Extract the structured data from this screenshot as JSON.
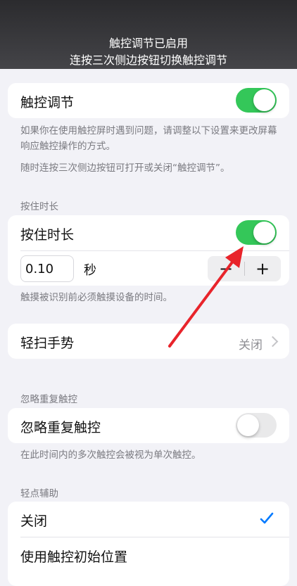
{
  "banner": {
    "line1": "触控调节已启用",
    "line2": "连按三次侧边按钮切换触控调节"
  },
  "touch_accommodations": {
    "label": "触控调节",
    "enabled": true,
    "note1": "如果你在使用触控屏时遇到问题，请调整以下设置来更改屏幕响应触控操作的方式。",
    "note2": "随时连按三次侧边按钮可打开或关闭“触控调节”。"
  },
  "hold_duration": {
    "section_title": "按住时长",
    "label": "按住时长",
    "enabled": true,
    "value": "0.10",
    "unit": "秒",
    "minus": "−",
    "plus": "+",
    "note": "触摸被识别前必须触摸设备的时间。"
  },
  "swipe_gestures": {
    "label": "轻扫手势",
    "value": "关闭"
  },
  "ignore_repeat": {
    "section_title": "忽略重复触控",
    "label": "忽略重复触控",
    "enabled": false,
    "note": "在此时间内的多次触控会被视为单次触控。"
  },
  "tap_assistance": {
    "section_title": "轻点辅助",
    "options": [
      {
        "label": "关闭",
        "selected": true
      },
      {
        "label": "使用触控初始位置",
        "selected": false
      }
    ]
  },
  "colors": {
    "toggle_on": "#34c759",
    "accent": "#007aff",
    "annotation_arrow": "#e8242b"
  }
}
